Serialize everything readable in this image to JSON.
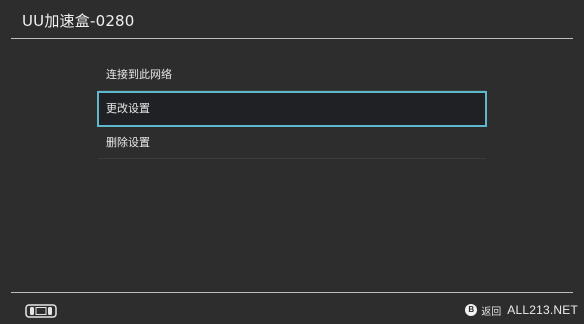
{
  "header": {
    "title": "UU加速盒-0280"
  },
  "menu": {
    "items": [
      {
        "label": "连接到此网络",
        "selected": false
      },
      {
        "label": "更改设置",
        "selected": true
      },
      {
        "label": "删除设置",
        "selected": false
      }
    ]
  },
  "footer": {
    "left_icon": "console-icon",
    "back_icon_glyph": "B",
    "back_label": "返回",
    "watermark": "ALL213.NET"
  },
  "colors": {
    "background": "#2d2d2d",
    "selection_outline": "#5fb7cc",
    "selection_fill": "#1f2125",
    "divider": "#bdbdbd"
  }
}
